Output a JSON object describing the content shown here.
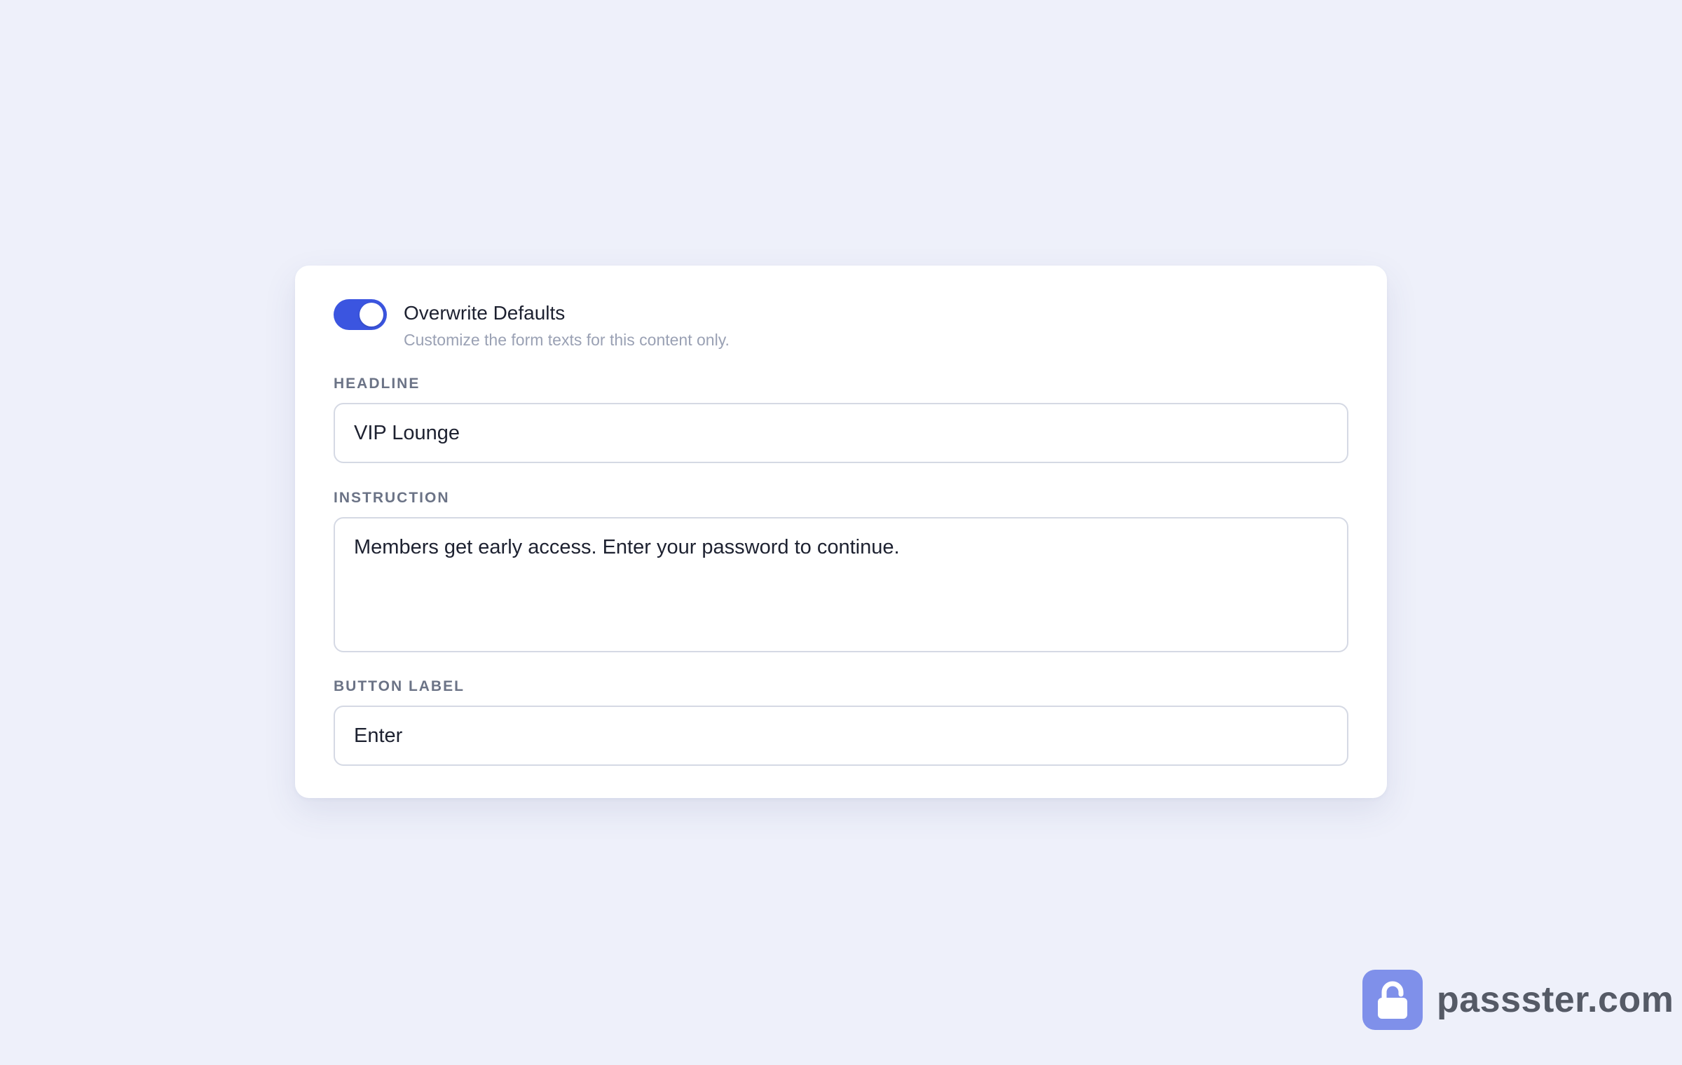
{
  "overwrite": {
    "title": "Overwrite Defaults",
    "description": "Customize the form texts for this content only.",
    "enabled": true,
    "accent_color": "#3b55e0"
  },
  "fields": {
    "headline": {
      "label": "HEADLINE",
      "value": "VIP Lounge"
    },
    "instruction": {
      "label": "INSTRUCTION",
      "value": "Members get early access. Enter your password to continue."
    },
    "button_label": {
      "label": "BUTTON LABEL",
      "value": "Enter"
    }
  },
  "brand": {
    "text": "passster.com",
    "icon": "lock-icon",
    "icon_color": "#7f90ea"
  }
}
